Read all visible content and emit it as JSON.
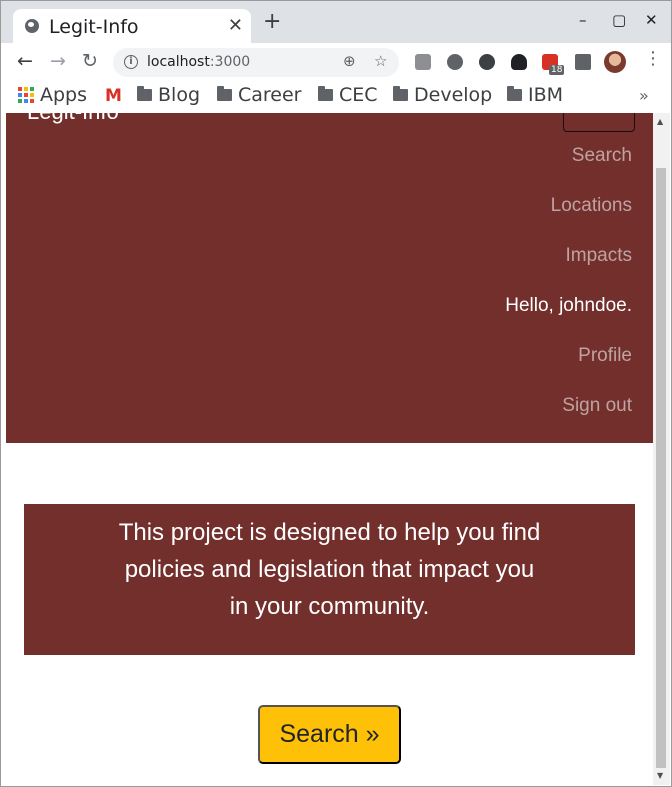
{
  "browser": {
    "tab_title": "Legit-Info",
    "tab_close": "✕",
    "new_tab": "+",
    "minimize": "–",
    "maximize": "▢",
    "close": "✕",
    "back": "←",
    "forward": "→",
    "reload": "↻",
    "url_host": "localhost",
    "url_port": ":3000",
    "zoom_icon": "⊕",
    "star_icon": "☆",
    "extensions_badge": "18",
    "menu": "⋮",
    "bookmarks_more": "»"
  },
  "bookmarks": [
    {
      "label": "Apps",
      "icon": "apps-grid-icon"
    },
    {
      "label": "",
      "icon": "gmail-icon"
    },
    {
      "label": "Blog",
      "icon": "folder-icon"
    },
    {
      "label": "Career",
      "icon": "folder-icon"
    },
    {
      "label": "CEC",
      "icon": "folder-icon"
    },
    {
      "label": "Develop",
      "icon": "folder-icon"
    },
    {
      "label": "IBM",
      "icon": "folder-icon"
    }
  ],
  "gmail_glyph": "M",
  "navbar": {
    "brand": "Legit-Info",
    "links": {
      "search": "Search",
      "locations": "Locations",
      "impacts": "Impacts",
      "greeting": "Hello, johndoe.",
      "profile": "Profile",
      "sign_out": "Sign out"
    }
  },
  "jumbotron": {
    "text": "This project is designed to help you find policies and legislation that impact you in your community."
  },
  "cta": {
    "search_button": "Search »"
  },
  "colors": {
    "brand_maroon": "#722f2c",
    "button_yellow": "#ffc107"
  }
}
